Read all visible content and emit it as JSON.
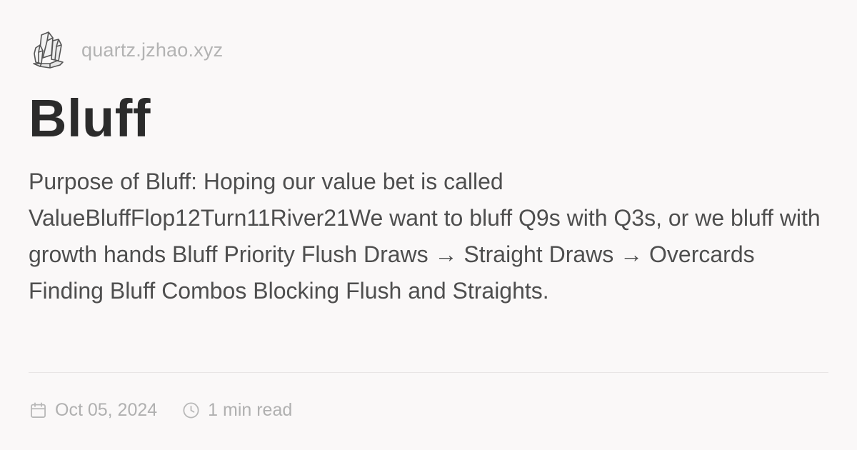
{
  "site": {
    "name": "quartz.jzhao.xyz",
    "logo_icon": "crystal-cluster-icon"
  },
  "article": {
    "title": "Bluff",
    "description": "Purpose of Bluff: Hoping our value bet is called ValueBluffFlop12Turn11River21We want to bluff Q9s with Q3s, or we bluff with growth hands Bluff Priority Flush Draws → Straight Draws → Overcards Finding Bluff Combos Blocking Flush and Straights."
  },
  "meta": {
    "date": "Oct 05, 2024",
    "date_icon": "calendar-icon",
    "reading_time": "1 min read",
    "reading_time_icon": "clock-icon"
  },
  "colors": {
    "background": "#faf8f8",
    "title": "#2b2b2b",
    "body_text": "#4e4e4e",
    "muted": "#b0b0b0"
  }
}
